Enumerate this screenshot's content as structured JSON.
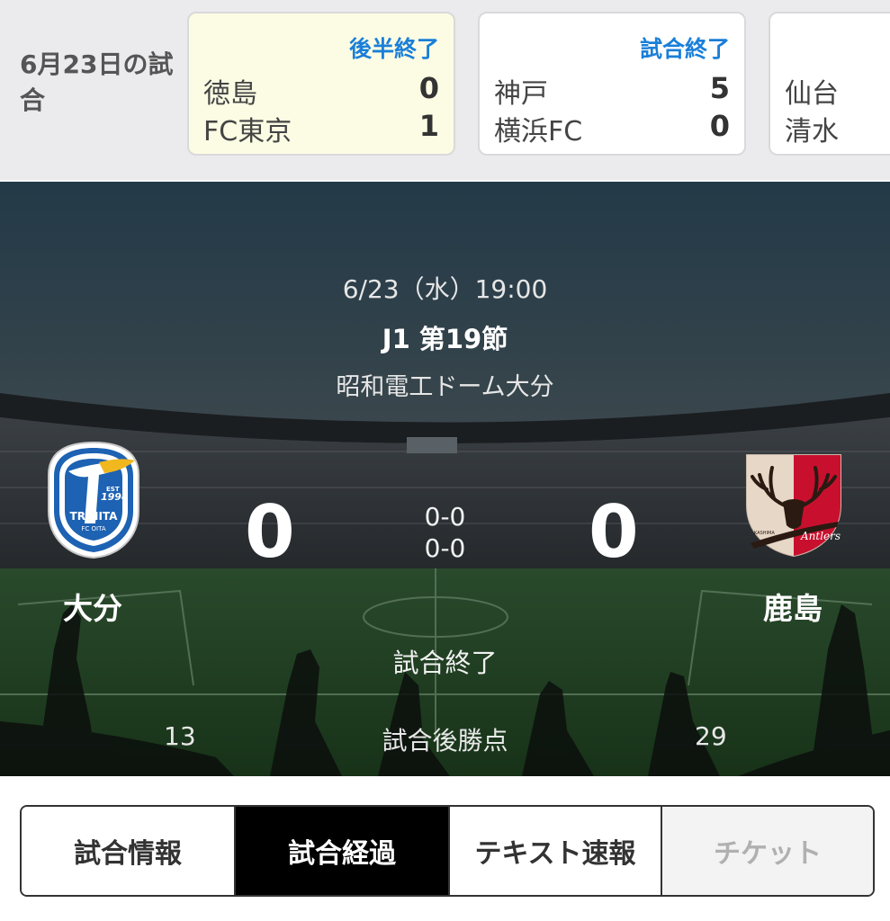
{
  "ticker": {
    "date_label": "6月23日の試合",
    "cards": [
      {
        "status": "後半終了",
        "home": "徳島",
        "home_score": "0",
        "away": "FC東京",
        "away_score": "1",
        "highlight": true
      },
      {
        "status": "試合終了",
        "home": "神戸",
        "home_score": "5",
        "away": "横浜FC",
        "away_score": "0",
        "highlight": false
      },
      {
        "status": "",
        "home": "仙台",
        "home_score": "",
        "away": "清水",
        "away_score": "",
        "highlight": false
      }
    ]
  },
  "match": {
    "datetime": "6/23（水）19:00",
    "round": "J1 第19節",
    "venue": "昭和電工ドーム大分",
    "home_team": "大分",
    "away_team": "鹿島",
    "home_score": "0",
    "away_score": "0",
    "first_half": "0-0",
    "second_half": "0-0",
    "status": "試合終了",
    "points_label": "試合後勝点",
    "home_points": "13",
    "away_points": "29",
    "home_crest_icon": "trinita-crest-icon",
    "away_crest_icon": "antlers-crest-icon",
    "home_crest_text": {
      "est": "EST",
      "year": "1994",
      "name": "TRINITA",
      "sub": "FC OITA"
    },
    "away_crest_text": {
      "name": "Antlers",
      "sub": "KASHIMA"
    }
  },
  "tabs": [
    {
      "label": "試合情報",
      "state": "normal"
    },
    {
      "label": "試合経過",
      "state": "active"
    },
    {
      "label": "テキスト速報",
      "state": "normal"
    },
    {
      "label": "チケット",
      "state": "disabled"
    }
  ],
  "colors": {
    "accent_blue": "#1a7fd8",
    "highlight_card": "#fcfce4",
    "active_tab": "#000000",
    "trinita_blue": "#1d62b3",
    "antlers_red": "#c8102e"
  }
}
